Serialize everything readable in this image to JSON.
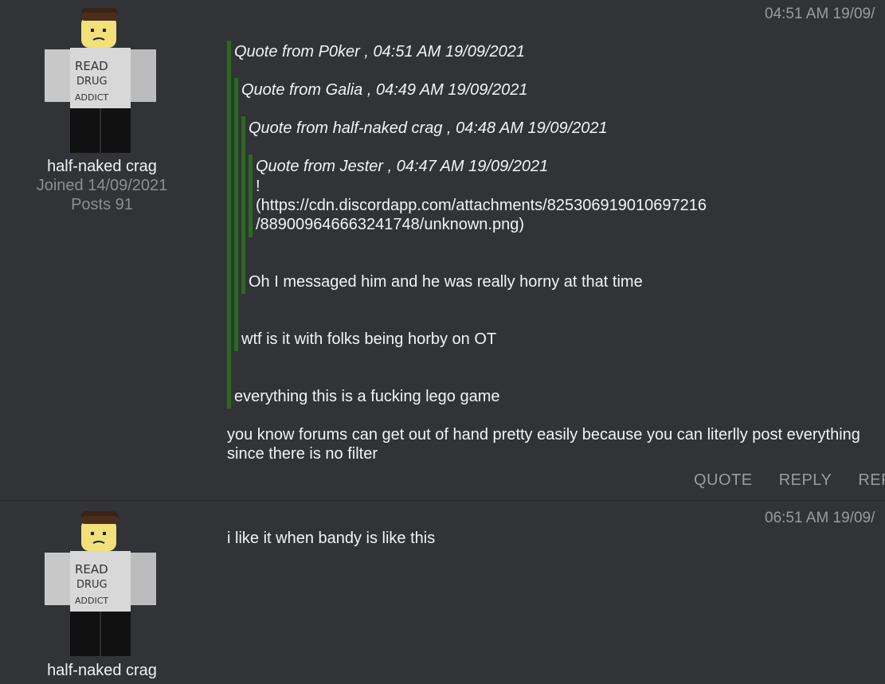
{
  "posts": [
    {
      "author": {
        "name": "half-naked crag",
        "joined": "Joined 14/09/2021",
        "posts": "Posts 91",
        "avatar_icon": "roblox-avatar-icon",
        "shirt_text": [
          "READ",
          "DRUG",
          "ADDICT"
        ]
      },
      "timestamp": "04:51 AM 19/09/",
      "quotes": [
        {
          "header": "Quote from P0ker , 04:51 AM 19/09/2021",
          "body": "everything this is a fucking lego game"
        },
        {
          "header": "Quote from Galia , 04:49 AM 19/09/2021",
          "body": "wtf is it with folks being horby on OT"
        },
        {
          "header": "Quote from half-naked crag , 04:48 AM 19/09/2021",
          "body": "Oh I messaged him and he was really horny at that time"
        },
        {
          "header": "Quote from Jester , 04:47 AM 19/09/2021",
          "body_lines": [
            "!",
            "(https://cdn.discordapp.com/attachments/825306919010697216",
            "/889009646663241748/unknown.png)"
          ]
        }
      ],
      "body": "you know forums can get out of hand pretty easily because you can literlly post everything since there is no filter",
      "actions": [
        "QUOTE",
        "REPLY",
        "REP"
      ]
    },
    {
      "author": {
        "name": "half-naked crag",
        "avatar_icon": "roblox-avatar-icon",
        "shirt_text": [
          "READ",
          "DRUG",
          "ADDICT"
        ]
      },
      "timestamp": "06:51 AM 19/09/",
      "body": "i like it when bandy is like this"
    }
  ],
  "colors": {
    "background": "#323337",
    "quote_bar": "#2a6a21",
    "muted_text": "#9a9b9f",
    "text": "#f3f3f3"
  }
}
